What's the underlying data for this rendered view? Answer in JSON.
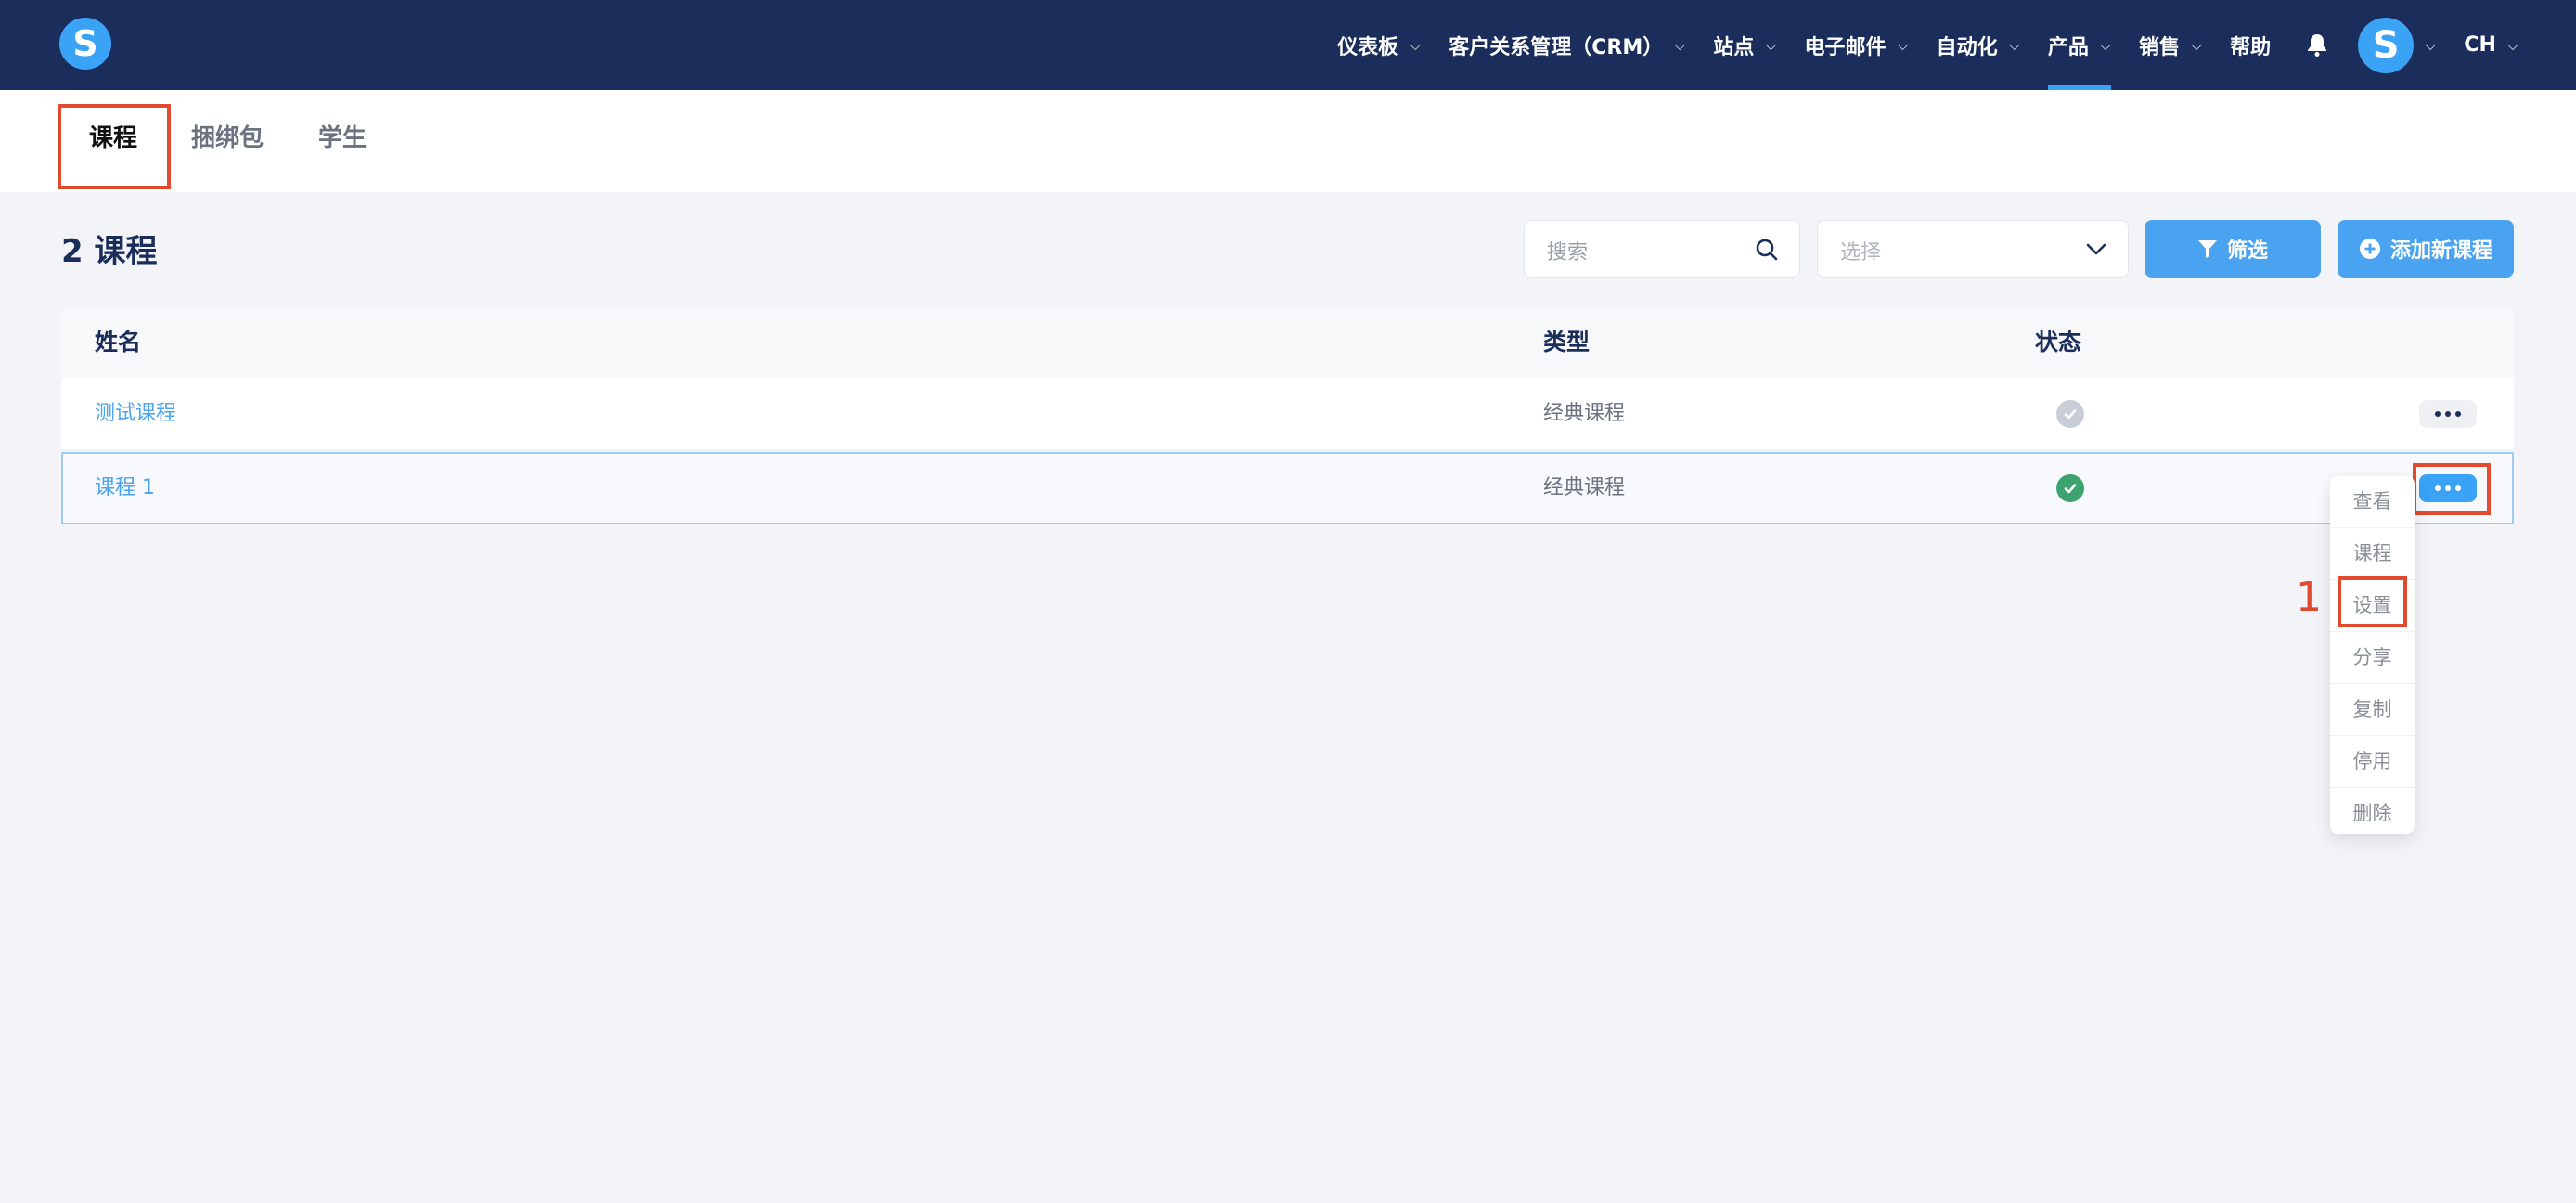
{
  "app": {
    "logo_letter": "S"
  },
  "nav": {
    "items": [
      {
        "label": "仪表板",
        "dropdown": true
      },
      {
        "label": "客户关系管理（CRM）",
        "dropdown": true
      },
      {
        "label": "站点",
        "dropdown": true
      },
      {
        "label": "电子邮件",
        "dropdown": true
      },
      {
        "label": "自动化",
        "dropdown": true
      },
      {
        "label": "产品",
        "dropdown": true,
        "active": true
      },
      {
        "label": "销售",
        "dropdown": true
      },
      {
        "label": "帮助",
        "dropdown": false
      }
    ],
    "avatar_letter": "S",
    "language": "CH"
  },
  "tabs": [
    {
      "label": "课程",
      "active": true
    },
    {
      "label": "捆绑包",
      "active": false
    },
    {
      "label": "学生",
      "active": false
    }
  ],
  "header": {
    "count_title": "2 课程",
    "search_placeholder": "搜索",
    "select_placeholder": "选择",
    "filter_label": "筛选",
    "add_label": "添加新课程"
  },
  "table": {
    "columns": [
      "姓名",
      "类型",
      "状态"
    ],
    "rows": [
      {
        "name": "测试课程",
        "type": "经典课程",
        "status": "inactive"
      },
      {
        "name": "课程 1",
        "type": "经典课程",
        "status": "active"
      }
    ]
  },
  "menu": {
    "items": [
      "查看",
      "课程",
      "设置",
      "分享",
      "复制",
      "停用",
      "删除"
    ]
  },
  "annotation": {
    "step": "1"
  },
  "colors": {
    "nav_bg": "#1b2d5b",
    "accent": "#4aa3f0",
    "highlight": "#e04a2f",
    "status_active": "#3da36f",
    "status_inactive": "#c8ced8"
  }
}
